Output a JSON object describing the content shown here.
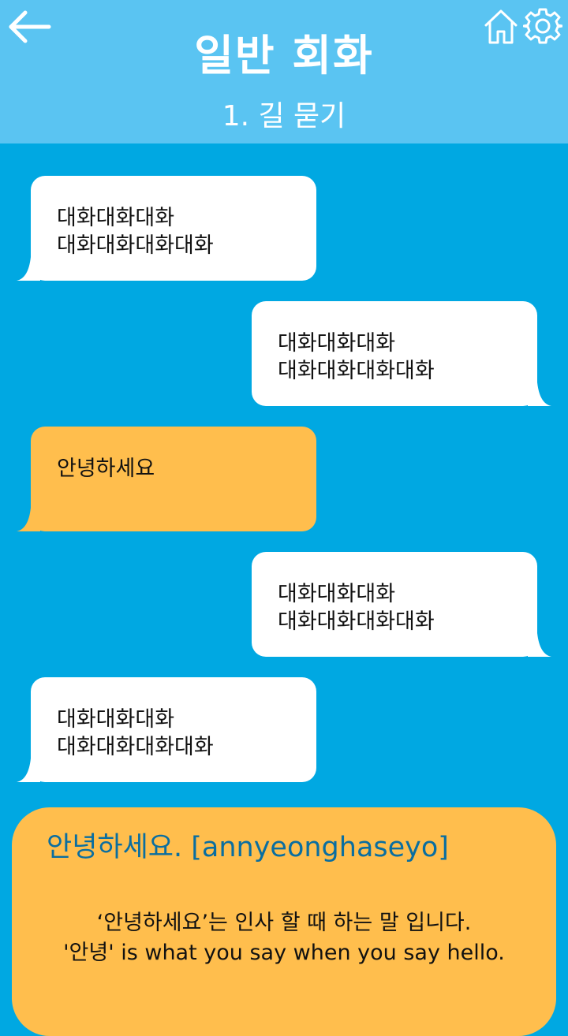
{
  "header": {
    "title": "일반 회화",
    "subtitle": "1. 길 묻기"
  },
  "messages": [
    {
      "side": "left",
      "color": "white",
      "lines": [
        "대화대화대화",
        "대화대화대화대화"
      ]
    },
    {
      "side": "right",
      "color": "white",
      "lines": [
        "대화대화대화",
        "대화대화대화대화"
      ]
    },
    {
      "side": "left",
      "color": "orange",
      "lines": [
        "안녕하세요"
      ]
    },
    {
      "side": "right",
      "color": "white",
      "lines": [
        "대화대화대화",
        "대화대화대화대화"
      ]
    },
    {
      "side": "left",
      "color": "white",
      "lines": [
        "대화대화대화",
        "대화대화대화대화"
      ]
    }
  ],
  "info": {
    "phrase": "안녕하세요. [annyeonghaseyo]",
    "desc_line1": "‘안녕하세요’는 인사 할 때 하는 말 입니다.",
    "desc_line2": "'안녕' is what you say when you say hello."
  },
  "colors": {
    "background": "#00a8e2",
    "header": "#5ac4f2",
    "bubble_white": "#ffffff",
    "bubble_orange": "#ffbe4d",
    "info_title": "#0a6ea0"
  },
  "icons": [
    "back-arrow-icon",
    "home-icon",
    "gear-icon"
  ]
}
